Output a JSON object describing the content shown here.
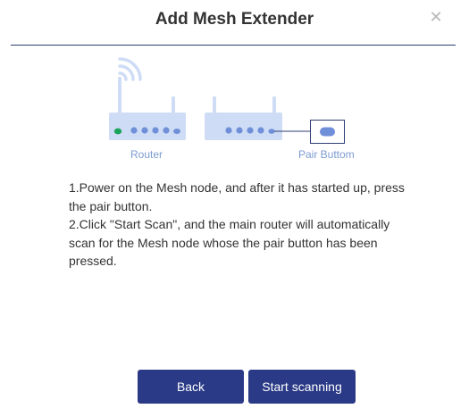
{
  "dialog": {
    "title": "Add Mesh Extender",
    "close_icon": "close-icon"
  },
  "illustration": {
    "router_label": "Router",
    "pair_button_label": "Pair Buttom",
    "colors": {
      "device": "#cfdcf5",
      "device_stroke": "#b9cbee",
      "port": "#6f8fd8",
      "active_port": "#1aa35b",
      "callout": "#2c3e73"
    }
  },
  "instructions": {
    "step1": "1.Power on the Mesh node, and after it has started up, press the pair button.",
    "step2": "2.Click \"Start Scan\", and the main router will automatically scan for the Mesh node whose the pair button has been pressed."
  },
  "buttons": {
    "back": "Back",
    "start_scanning": "Start scanning"
  },
  "colors": {
    "primary": "#2a3a86",
    "title_text": "#333333",
    "label_text": "#7b9bd0"
  }
}
